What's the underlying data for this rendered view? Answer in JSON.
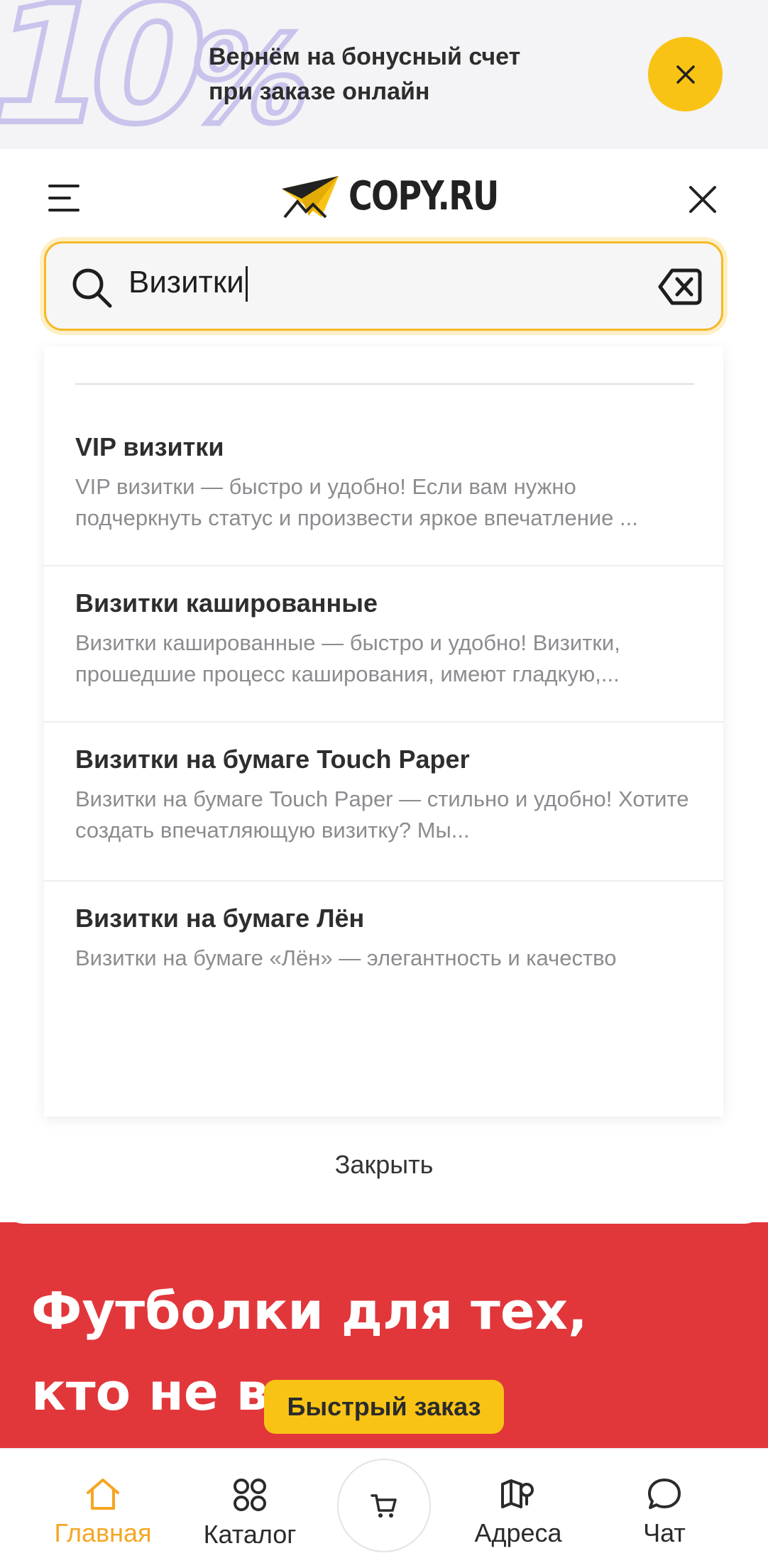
{
  "promo": {
    "graphic_text": "10",
    "graphic_percent": "%",
    "line1": "Вернём на бонусный счет",
    "line2": "при заказе онлайн"
  },
  "header": {
    "logo_text": "COPY.RU"
  },
  "search": {
    "value": "Визитки"
  },
  "results": [
    {
      "title": "VIP визитки",
      "desc": "VIP визитки — быстро и удобно! Если вам нужно подчеркнуть статус и произвести яркое впечатление ..."
    },
    {
      "title": "Визитки кашированные",
      "desc": "Визитки кашированные — быстро и удобно! Визитки, прошедшие процесс каширования, имеют гладкую,..."
    },
    {
      "title": "Визитки на бумаге Touch Paper",
      "desc": "Визитки на бумаге Touch Paper — стильно и удобно! Хотите создать впечатляющую визитку? Мы..."
    },
    {
      "title": "Визитки на бумаге Лён",
      "desc": "Визитки на бумаге «Лён» — элегантность и качество"
    }
  ],
  "close_label": "Закрыть",
  "red_promo": {
    "line1": "Футболки для тех,",
    "line2": "кто не в запасе"
  },
  "quick_order_label": "Быстрый заказ",
  "nav": {
    "home": "Главная",
    "catalog": "Каталог",
    "addresses": "Адреса",
    "chat": "Чат"
  },
  "colors": {
    "accent_yellow": "#f8c315",
    "active_nav": "#f5a623",
    "promo_red": "#e1373b"
  },
  "icons": [
    "close-icon",
    "menu-icon",
    "logo-plane-icon",
    "search-icon",
    "clear-input-icon",
    "home-icon",
    "catalog-icon",
    "cart-icon",
    "map-icon",
    "chat-icon"
  ]
}
